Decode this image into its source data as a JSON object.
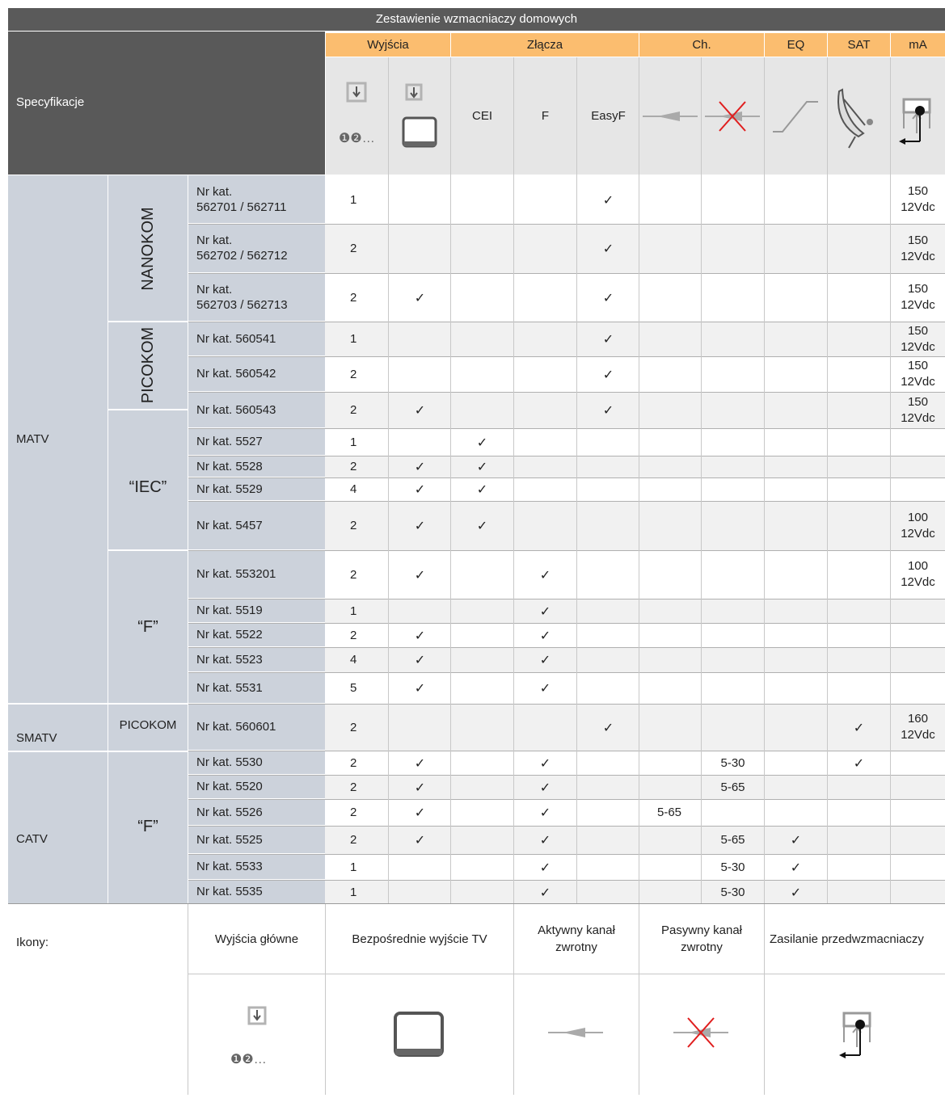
{
  "title": "Zestawienie wzmacniaczy domowych",
  "spec_label": "Specyfikacje",
  "groups": {
    "outputs": "Wyjścia",
    "connectors": "Złącza",
    "channel": "Ch.",
    "eq": "EQ",
    "sat": "SAT",
    "ma": "mA"
  },
  "connector_labels": [
    "CEI",
    "F",
    "EasyF"
  ],
  "output_icon_marks": "❶❷…",
  "categories": {
    "matv": "MATV",
    "smatv": "SMATV",
    "catv": "CATV"
  },
  "families": {
    "nanokom": "NANOKOM",
    "picokom": "PICOKOM",
    "iec": "“IEC”",
    "f1": "“F”",
    "picokom_smatv": "PICOKOM",
    "f2": "“F”"
  },
  "rows": [
    {
      "label": "Nr kat.\n562701 / 562711",
      "out": "1",
      "tv": "",
      "cei": "",
      "f": "",
      "easyf": "✓",
      "active": "",
      "passive": "",
      "eq": "",
      "sat": "",
      "ma": "150\n12Vdc"
    },
    {
      "label": "Nr kat.\n562702 / 562712",
      "out": "2",
      "tv": "",
      "cei": "",
      "f": "",
      "easyf": "✓",
      "active": "",
      "passive": "",
      "eq": "",
      "sat": "",
      "ma": "150\n12Vdc"
    },
    {
      "label": "Nr kat.\n562703 / 562713",
      "out": "2",
      "tv": "✓",
      "cei": "",
      "f": "",
      "easyf": "✓",
      "active": "",
      "passive": "",
      "eq": "",
      "sat": "",
      "ma": "150\n12Vdc"
    },
    {
      "label": "Nr kat. 560541",
      "out": "1",
      "tv": "",
      "cei": "",
      "f": "",
      "easyf": "✓",
      "active": "",
      "passive": "",
      "eq": "",
      "sat": "",
      "ma": "150\n12Vdc"
    },
    {
      "label": "Nr kat. 560542",
      "out": "2",
      "tv": "",
      "cei": "",
      "f": "",
      "easyf": "✓",
      "active": "",
      "passive": "",
      "eq": "",
      "sat": "",
      "ma": "150\n12Vdc"
    },
    {
      "label": "Nr kat. 560543",
      "out": "2",
      "tv": "✓",
      "cei": "",
      "f": "",
      "easyf": "✓",
      "active": "",
      "passive": "",
      "eq": "",
      "sat": "",
      "ma": "150\n12Vdc"
    },
    {
      "label": "Nr kat. 5527",
      "out": "1",
      "tv": "",
      "cei": "✓",
      "f": "",
      "easyf": "",
      "active": "",
      "passive": "",
      "eq": "",
      "sat": "",
      "ma": ""
    },
    {
      "label": "Nr kat. 5528",
      "out": "2",
      "tv": "✓",
      "cei": "✓",
      "f": "",
      "easyf": "",
      "active": "",
      "passive": "",
      "eq": "",
      "sat": "",
      "ma": ""
    },
    {
      "label": "Nr kat. 5529",
      "out": "4",
      "tv": "✓",
      "cei": "✓",
      "f": "",
      "easyf": "",
      "active": "",
      "passive": "",
      "eq": "",
      "sat": "",
      "ma": ""
    },
    {
      "label": "Nr kat. 5457",
      "out": "2",
      "tv": "✓",
      "cei": "✓",
      "f": "",
      "easyf": "",
      "active": "",
      "passive": "",
      "eq": "",
      "sat": "",
      "ma": "100\n12Vdc"
    },
    {
      "label": "Nr kat. 553201",
      "out": "2",
      "tv": "✓",
      "cei": "",
      "f": "✓",
      "easyf": "",
      "active": "",
      "passive": "",
      "eq": "",
      "sat": "",
      "ma": "100\n12Vdc"
    },
    {
      "label": "Nr kat. 5519",
      "out": "1",
      "tv": "",
      "cei": "",
      "f": "✓",
      "easyf": "",
      "active": "",
      "passive": "",
      "eq": "",
      "sat": "",
      "ma": ""
    },
    {
      "label": "Nr kat. 5522",
      "out": "2",
      "tv": "✓",
      "cei": "",
      "f": "✓",
      "easyf": "",
      "active": "",
      "passive": "",
      "eq": "",
      "sat": "",
      "ma": ""
    },
    {
      "label": "Nr kat. 5523",
      "out": "4",
      "tv": "✓",
      "cei": "",
      "f": "✓",
      "easyf": "",
      "active": "",
      "passive": "",
      "eq": "",
      "sat": "",
      "ma": ""
    },
    {
      "label": "Nr kat. 5531",
      "out": "5",
      "tv": "✓",
      "cei": "",
      "f": "✓",
      "easyf": "",
      "active": "",
      "passive": "",
      "eq": "",
      "sat": "",
      "ma": ""
    },
    {
      "label": "Nr kat. 560601",
      "out": "2",
      "tv": "",
      "cei": "",
      "f": "",
      "easyf": "✓",
      "active": "",
      "passive": "",
      "eq": "",
      "sat": "✓",
      "ma": "160\n12Vdc"
    },
    {
      "label": "Nr kat. 5530",
      "out": "2",
      "tv": "✓",
      "cei": "",
      "f": "✓",
      "easyf": "",
      "active": "",
      "passive": "5-30",
      "eq": "",
      "sat": "✓",
      "ma": ""
    },
    {
      "label": "Nr kat. 5520",
      "out": "2",
      "tv": "✓",
      "cei": "",
      "f": "✓",
      "easyf": "",
      "active": "",
      "passive": "5-65",
      "eq": "",
      "sat": "",
      "ma": ""
    },
    {
      "label": "Nr kat. 5526",
      "out": "2",
      "tv": "✓",
      "cei": "",
      "f": "✓",
      "easyf": "",
      "active": "5-65",
      "passive": "",
      "eq": "",
      "sat": "",
      "ma": ""
    },
    {
      "label": "Nr kat. 5525",
      "out": "2",
      "tv": "✓",
      "cei": "",
      "f": "✓",
      "easyf": "",
      "active": "",
      "passive": "5-65",
      "eq": "✓",
      "sat": "",
      "ma": ""
    },
    {
      "label": "Nr kat. 5533",
      "out": "1",
      "tv": "",
      "cei": "",
      "f": "✓",
      "easyf": "",
      "active": "",
      "passive": "5-30",
      "eq": "✓",
      "sat": "",
      "ma": ""
    },
    {
      "label": "Nr kat. 5535",
      "out": "1",
      "tv": "",
      "cei": "",
      "f": "✓",
      "easyf": "",
      "active": "",
      "passive": "5-30",
      "eq": "✓",
      "sat": "",
      "ma": ""
    }
  ],
  "legend": {
    "title": "Ikony:",
    "main_outputs": "Wyjścia główne",
    "direct_tv": "Bezpośrednie wyjście TV",
    "active_return": "Aktywny kanał\nzwrotny",
    "passive_return": "Pasywny kanał\nzwrotny",
    "preamp_power": "Zasilanie przedwzmacniaczy",
    "marks": "❶❷…"
  }
}
